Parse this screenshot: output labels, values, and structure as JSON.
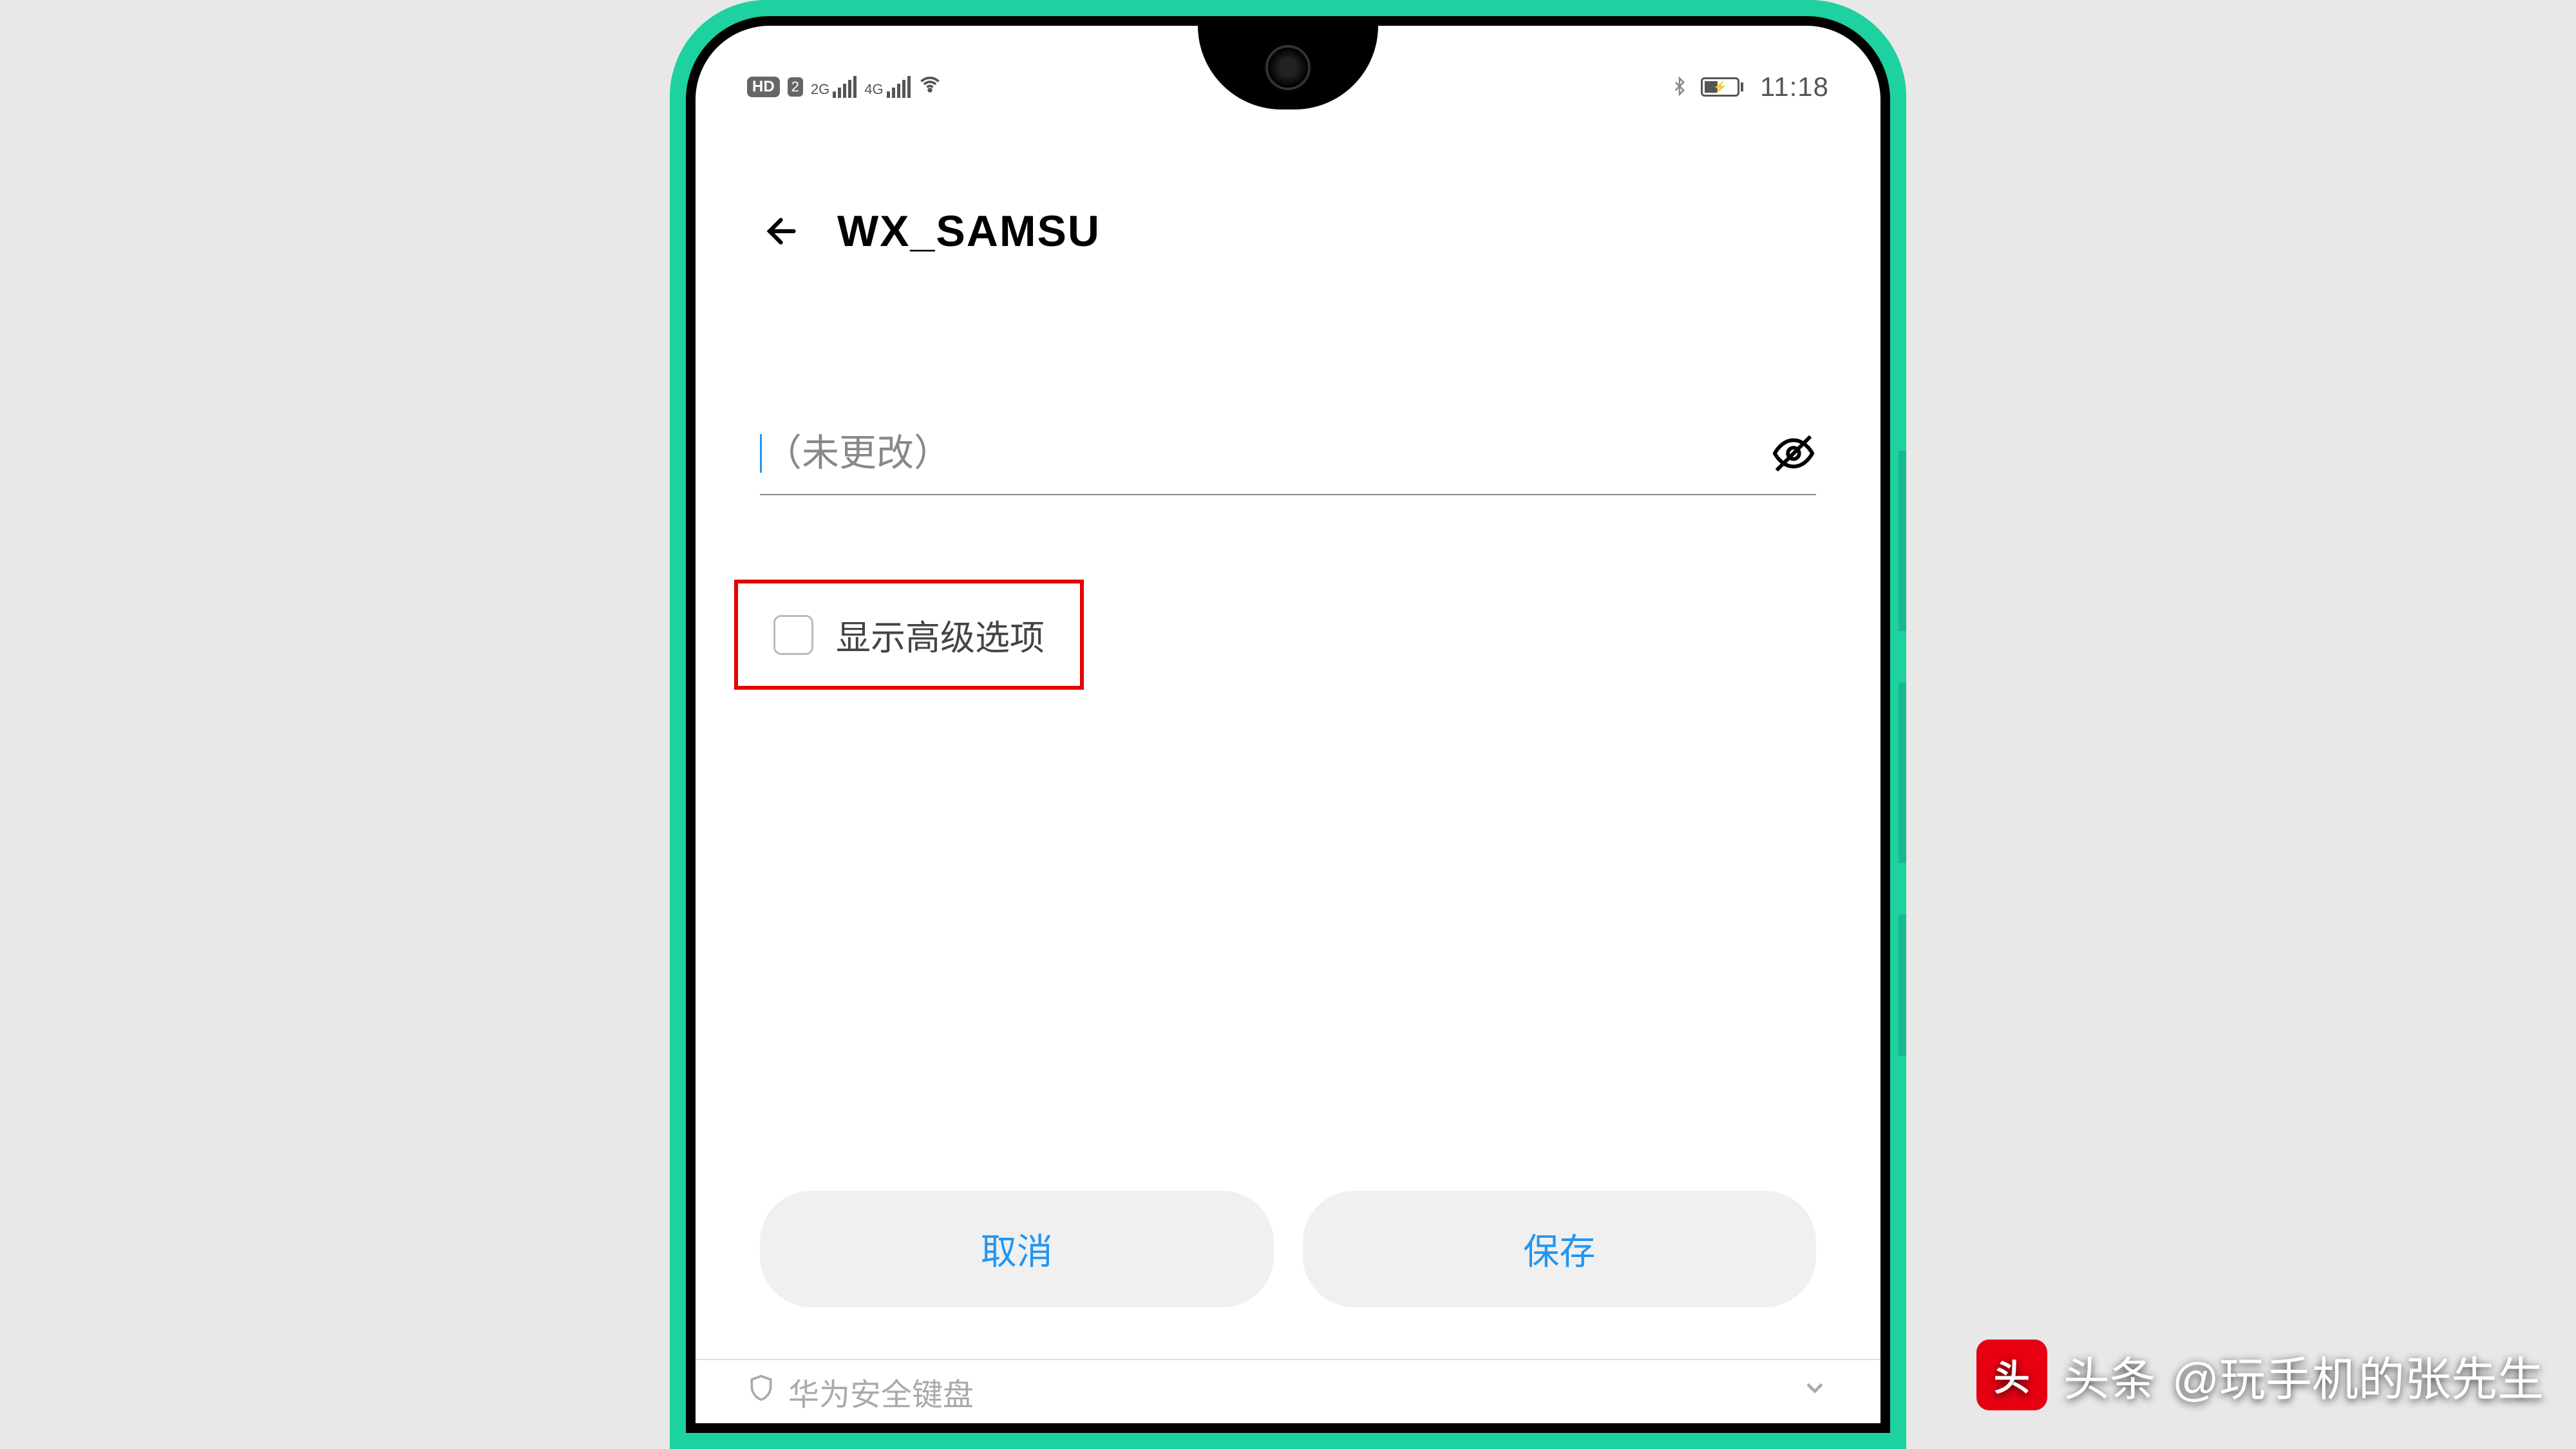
{
  "statusBar": {
    "hd": "HD",
    "sim": "2",
    "sig1": "2G",
    "sig2": "4G",
    "time": "11:18"
  },
  "header": {
    "title": "WX_SAMSU"
  },
  "passwordField": {
    "placeholder": "（未更改）",
    "value": ""
  },
  "advancedOption": {
    "label": "显示高级选项",
    "checked": false
  },
  "buttons": {
    "cancel": "取消",
    "save": "保存"
  },
  "keyboard": {
    "hint": "华为安全键盘"
  },
  "watermark": {
    "brand": "头条",
    "author": "@玩手机的张先生"
  }
}
